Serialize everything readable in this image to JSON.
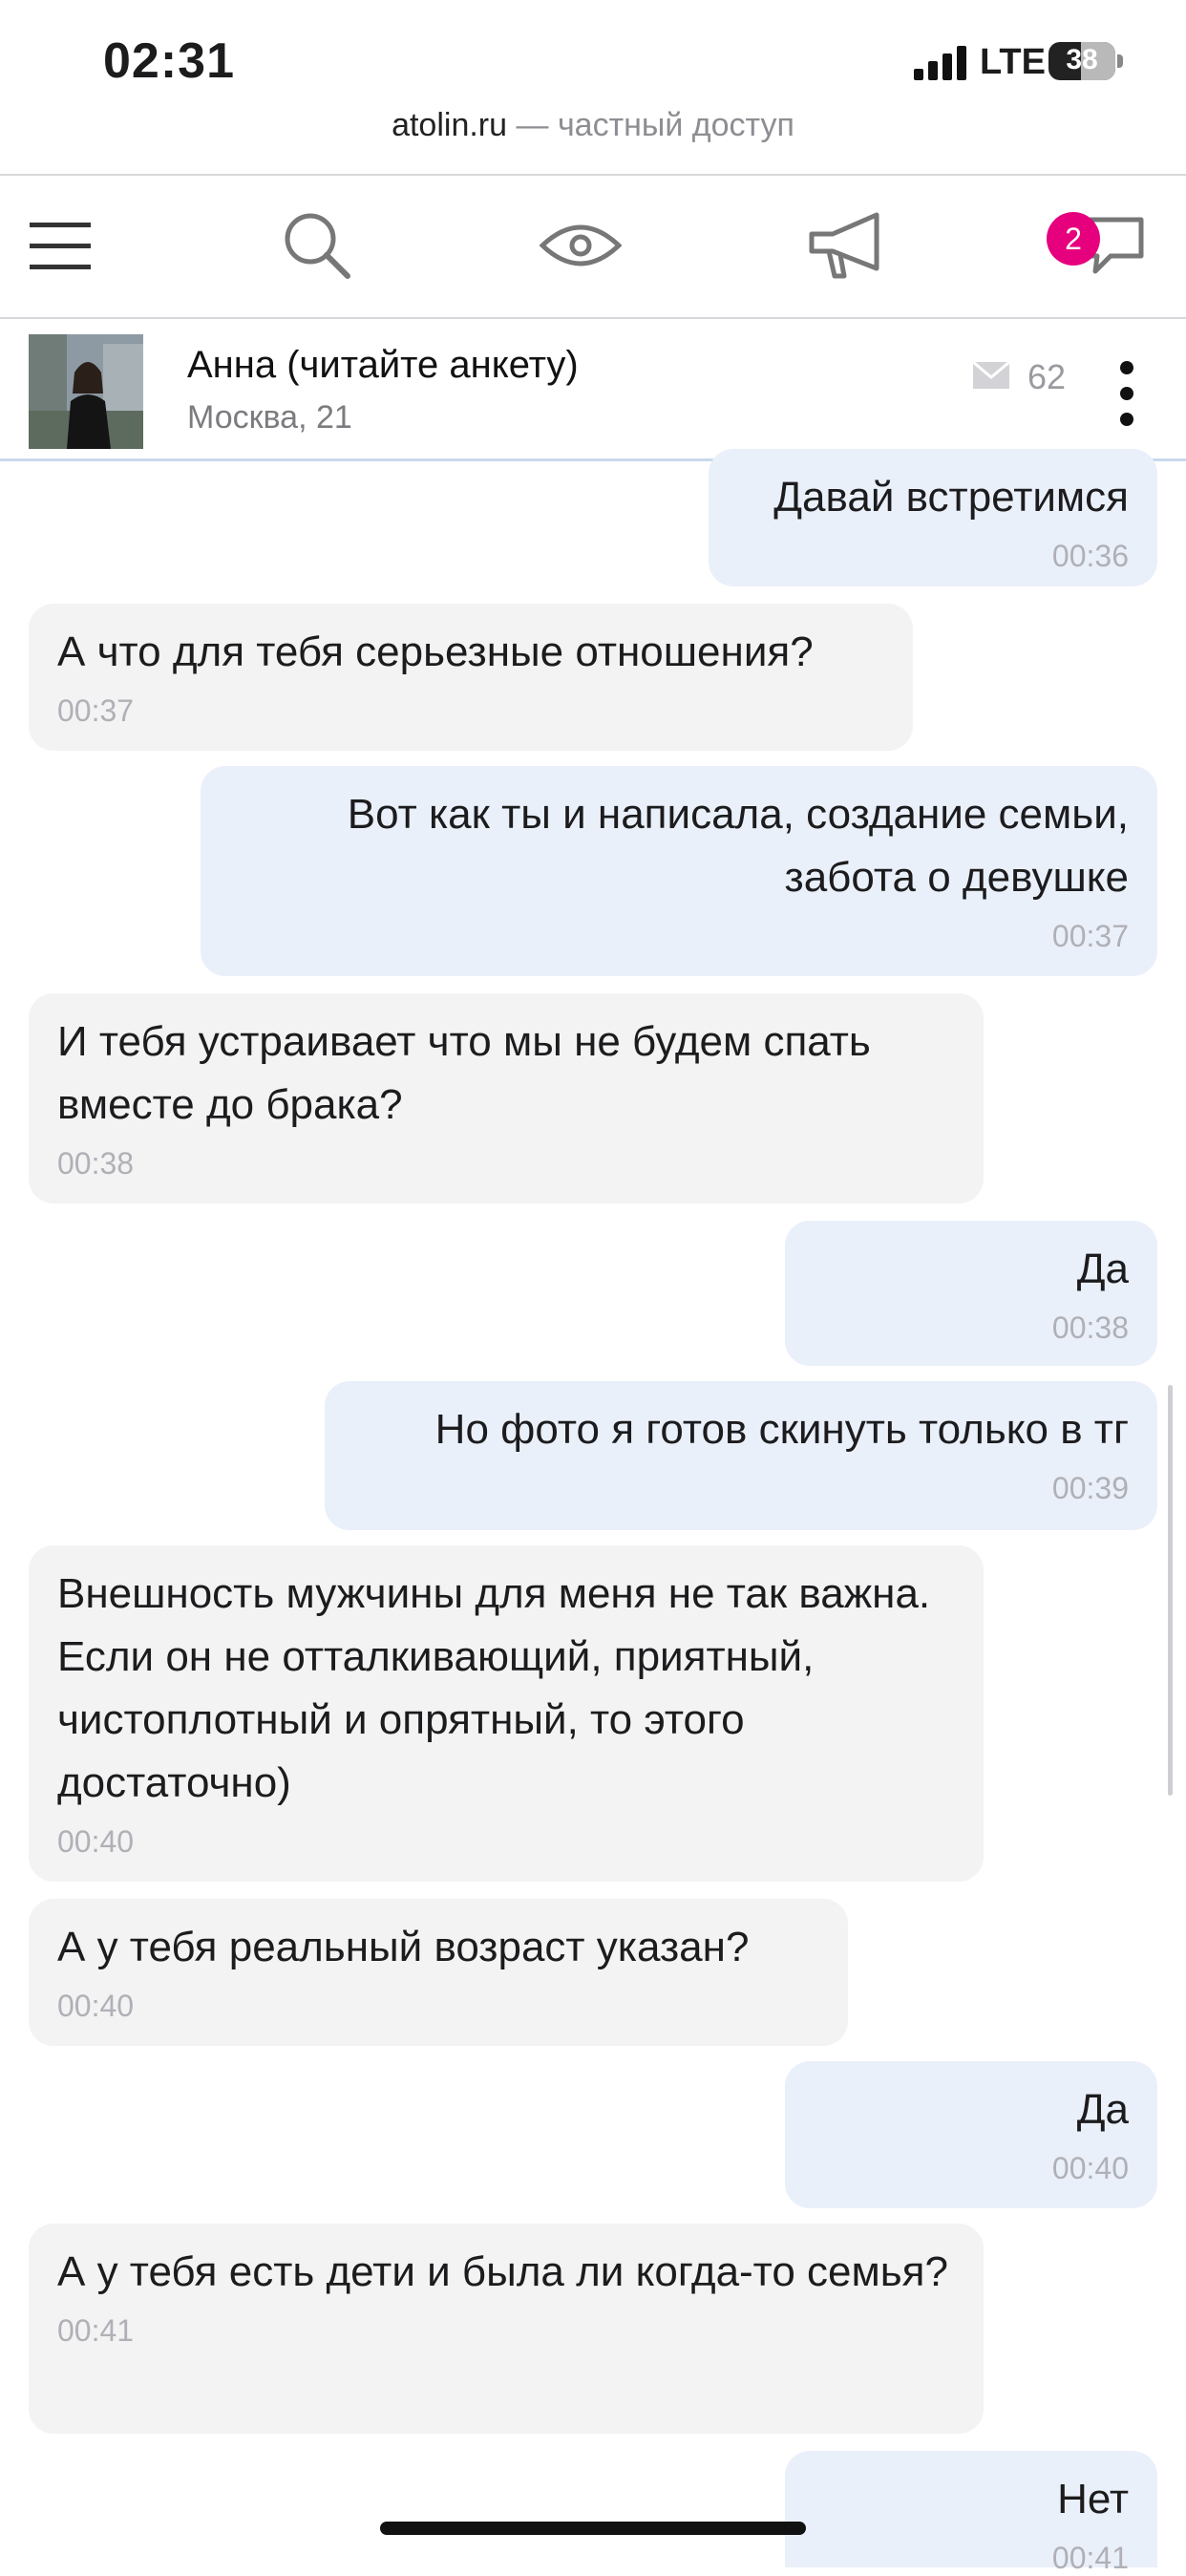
{
  "status_bar": {
    "time": "02:31",
    "network": "LTE",
    "battery": "38"
  },
  "browser": {
    "domain": "atolin.ru",
    "suffix": " — частный доступ"
  },
  "nav": {
    "items": [
      "menu-icon",
      "search-icon",
      "eye-icon",
      "megaphone-icon",
      "chat-icon"
    ],
    "chat_badge": "2"
  },
  "profile": {
    "name": "Анна (читайте анкету)",
    "city_age": "Москва, 21",
    "message_count": "62"
  },
  "messages": [
    {
      "dir": "out",
      "text": "Давай встретимся",
      "time": "00:36"
    },
    {
      "dir": "in",
      "text": "А что для тебя серьезные отношения?",
      "time": "00:37"
    },
    {
      "dir": "out",
      "text": "Вот как ты и написала, создание семьи, забота о девушке",
      "time": "00:37"
    },
    {
      "dir": "in",
      "text": "И тебя устраивает что мы не будем спать вместе до брака?",
      "time": "00:38"
    },
    {
      "dir": "out",
      "text": "Да",
      "time": "00:38"
    },
    {
      "dir": "out",
      "text": "Но фото я готов скинуть только в тг",
      "time": "00:39"
    },
    {
      "dir": "in",
      "text": "Внешность мужчины для меня не так важна. Если он не отталкивающий, приятный, чистоплотный и опрятный, то этого достаточно)",
      "time": "00:40"
    },
    {
      "dir": "in",
      "text": "А у тебя реальный возраст указан?",
      "time": "00:40"
    },
    {
      "dir": "out",
      "text": "Да",
      "time": "00:40"
    },
    {
      "dir": "in",
      "text": "А у тебя есть дети и была ли когда-то семья?",
      "time": "00:41"
    },
    {
      "dir": "out",
      "text": "Нет",
      "time": "00:41"
    }
  ],
  "colors": {
    "incoming_bubble": "#f3f3f4",
    "outgoing_bubble": "#eaf0fa",
    "badge": "#e6007e",
    "timestamp": "#b0b0b6"
  }
}
